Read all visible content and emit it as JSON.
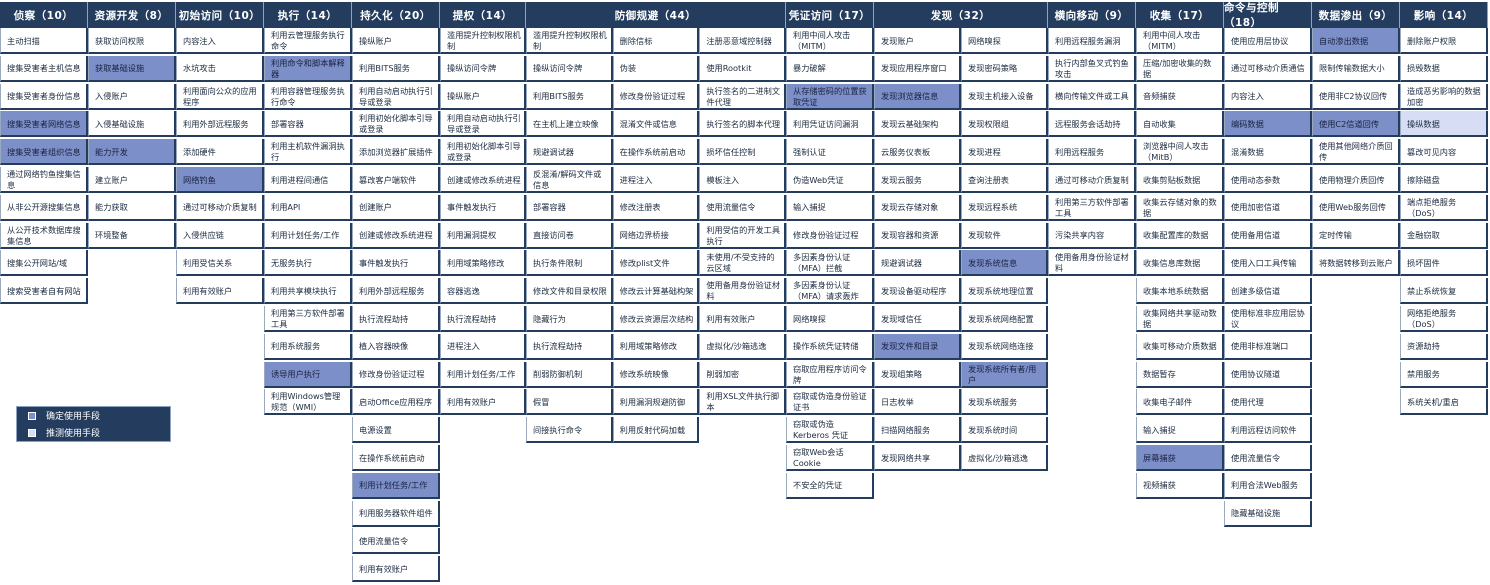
{
  "colors": {
    "header_bg": "#243d5e",
    "confirmed": "#7c8fc9",
    "suspected": "#d6ddf5",
    "cell_border": "#243d5e"
  },
  "legend": {
    "confirmed": "确定使用手段",
    "suspected": "推测使用手段"
  },
  "tactics": [
    {
      "name": "侦察（10）",
      "techniques": [
        {
          "label": "主动扫描",
          "state": ""
        },
        {
          "label": "搜集受害者主机信息",
          "state": ""
        },
        {
          "label": "搜集受害者身份信息",
          "state": ""
        },
        {
          "label": "搜集受害者网络信息",
          "state": "confirmed"
        },
        {
          "label": "搜集受害者组织信息",
          "state": "confirmed"
        },
        {
          "label": "通过网络钓鱼搜集信息",
          "state": ""
        },
        {
          "label": "从非公开源搜集信息",
          "state": ""
        },
        {
          "label": "从公开技术数据库搜集信息",
          "state": ""
        },
        {
          "label": "搜集公开网站/域",
          "state": ""
        },
        {
          "label": "搜索受害者自有网站",
          "state": ""
        }
      ]
    },
    {
      "name": "资源开发（8）",
      "techniques": [
        {
          "label": "获取访问权限",
          "state": ""
        },
        {
          "label": "获取基础设施",
          "state": "confirmed"
        },
        {
          "label": "入侵账户",
          "state": ""
        },
        {
          "label": "入侵基础设施",
          "state": ""
        },
        {
          "label": "能力开发",
          "state": "confirmed"
        },
        {
          "label": "建立账户",
          "state": ""
        },
        {
          "label": "能力获取",
          "state": ""
        },
        {
          "label": "环境整备",
          "state": ""
        }
      ]
    },
    {
      "name": "初始访问（10）",
      "techniques": [
        {
          "label": "内容注入",
          "state": ""
        },
        {
          "label": "水坑攻击",
          "state": ""
        },
        {
          "label": "利用面向公众的应用程序",
          "state": ""
        },
        {
          "label": "利用外部远程服务",
          "state": ""
        },
        {
          "label": "添加硬件",
          "state": ""
        },
        {
          "label": "网络钓鱼",
          "state": "confirmed"
        },
        {
          "label": "通过可移动介质复制",
          "state": ""
        },
        {
          "label": "入侵供应链",
          "state": ""
        },
        {
          "label": "利用受信关系",
          "state": ""
        },
        {
          "label": "利用有效账户",
          "state": ""
        }
      ]
    },
    {
      "name": "执行（14）",
      "techniques": [
        {
          "label": "利用云管理服务执行命令",
          "state": ""
        },
        {
          "label": "利用命令和脚本解释器",
          "state": "confirmed"
        },
        {
          "label": "利用容器管理服务执行命令",
          "state": ""
        },
        {
          "label": "部署容器",
          "state": ""
        },
        {
          "label": "利用主机软件漏洞执行",
          "state": ""
        },
        {
          "label": "利用进程间通信",
          "state": ""
        },
        {
          "label": "利用API",
          "state": ""
        },
        {
          "label": "利用计划任务/工作",
          "state": ""
        },
        {
          "label": "无服务执行",
          "state": ""
        },
        {
          "label": "利用共享模块执行",
          "state": ""
        },
        {
          "label": "利用第三方软件部署工具",
          "state": ""
        },
        {
          "label": "利用系统服务",
          "state": ""
        },
        {
          "label": "诱导用户执行",
          "state": "confirmed"
        },
        {
          "label": "利用Windows管理规范（WMI）",
          "state": ""
        }
      ]
    },
    {
      "name": "持久化（20）",
      "techniques": [
        {
          "label": "操纵账户",
          "state": ""
        },
        {
          "label": "利用BITS服务",
          "state": ""
        },
        {
          "label": "利用自动启动执行引导或登录",
          "state": ""
        },
        {
          "label": "利用初始化脚本引导或登录",
          "state": ""
        },
        {
          "label": "添加浏览器扩展插件",
          "state": ""
        },
        {
          "label": "篡改客户端软件",
          "state": ""
        },
        {
          "label": "创建账户",
          "state": ""
        },
        {
          "label": "创建或修改系统进程",
          "state": ""
        },
        {
          "label": "事件触发执行",
          "state": ""
        },
        {
          "label": "利用外部远程服务",
          "state": ""
        },
        {
          "label": "执行流程劫持",
          "state": ""
        },
        {
          "label": "植入容器映像",
          "state": ""
        },
        {
          "label": "修改身份验证过程",
          "state": ""
        },
        {
          "label": "启动Office应用程序",
          "state": ""
        },
        {
          "label": "电源设置",
          "state": ""
        },
        {
          "label": "在操作系统前启动",
          "state": ""
        },
        {
          "label": "利用计划任务/工作",
          "state": "confirmed"
        },
        {
          "label": "利用服务器软件组件",
          "state": ""
        },
        {
          "label": "使用流量信令",
          "state": ""
        },
        {
          "label": "利用有效账户",
          "state": ""
        }
      ]
    },
    {
      "name": "提权（14）",
      "techniques": [
        {
          "label": "滥用提升控制权限机制",
          "state": ""
        },
        {
          "label": "操纵访问令牌",
          "state": ""
        },
        {
          "label": "操纵账户",
          "state": ""
        },
        {
          "label": "利用自动启动执行引导或登录",
          "state": ""
        },
        {
          "label": "利用初始化脚本引导或登录",
          "state": ""
        },
        {
          "label": "创建或修改系统进程",
          "state": ""
        },
        {
          "label": "事件触发执行",
          "state": ""
        },
        {
          "label": "利用漏洞提权",
          "state": ""
        },
        {
          "label": "利用域策略修改",
          "state": ""
        },
        {
          "label": "容器逃逸",
          "state": ""
        },
        {
          "label": "执行流程劫持",
          "state": ""
        },
        {
          "label": "进程注入",
          "state": ""
        },
        {
          "label": "利用计划任务/工作",
          "state": ""
        },
        {
          "label": "利用有效账户",
          "state": ""
        }
      ]
    },
    {
      "name": "防御规避（44）",
      "techniques": [
        {
          "label": "滥用提升控制权限机制",
          "state": ""
        },
        {
          "label": "操纵访问令牌",
          "state": ""
        },
        {
          "label": "利用BITS服务",
          "state": ""
        },
        {
          "label": "在主机上建立映像",
          "state": ""
        },
        {
          "label": "规避调试器",
          "state": ""
        },
        {
          "label": "反混淆/解码文件或信息",
          "state": ""
        },
        {
          "label": "部署容器",
          "state": ""
        },
        {
          "label": "直接访问卷",
          "state": ""
        },
        {
          "label": "执行条件限制",
          "state": ""
        },
        {
          "label": "修改文件和目录权限",
          "state": ""
        },
        {
          "label": "隐藏行为",
          "state": ""
        },
        {
          "label": "执行流程劫持",
          "state": ""
        },
        {
          "label": "削弱防御机制",
          "state": ""
        },
        {
          "label": "假冒",
          "state": ""
        },
        {
          "label": "间接执行命令",
          "state": ""
        },
        {
          "label": "删除信标",
          "state": ""
        },
        {
          "label": "伪装",
          "state": ""
        },
        {
          "label": "修改身份验证过程",
          "state": ""
        },
        {
          "label": "混淆文件或信息",
          "state": ""
        },
        {
          "label": "在操作系统前启动",
          "state": ""
        },
        {
          "label": "进程注入",
          "state": ""
        },
        {
          "label": "修改注册表",
          "state": ""
        },
        {
          "label": "网络边界桥接",
          "state": ""
        },
        {
          "label": "修改plist文件",
          "state": ""
        },
        {
          "label": "修改云计算基础构架",
          "state": ""
        },
        {
          "label": "修改云资源层次结构",
          "state": ""
        },
        {
          "label": "利用域策略修改",
          "state": ""
        },
        {
          "label": "修改系统映像",
          "state": ""
        },
        {
          "label": "利用漏洞规避防御",
          "state": ""
        },
        {
          "label": "利用反射代码加载",
          "state": ""
        },
        {
          "label": "注册恶意域控制器",
          "state": ""
        },
        {
          "label": "使用Rootkit",
          "state": ""
        },
        {
          "label": "执行签名的二进制文件代理",
          "state": ""
        },
        {
          "label": "执行签名的脚本代理",
          "state": ""
        },
        {
          "label": "损坏信任控制",
          "state": ""
        },
        {
          "label": "模板注入",
          "state": ""
        },
        {
          "label": "使用流量信令",
          "state": ""
        },
        {
          "label": "利用受信的开发工具执行",
          "state": ""
        },
        {
          "label": "未使用/不受支持的云区域",
          "state": ""
        },
        {
          "label": "使用备用身份验证材料",
          "state": ""
        },
        {
          "label": "利用有效账户",
          "state": ""
        },
        {
          "label": "虚拟化/沙箱逃逸",
          "state": ""
        },
        {
          "label": "削弱加密",
          "state": ""
        },
        {
          "label": "利用XSL文件执行脚本",
          "state": ""
        }
      ]
    },
    {
      "name": "凭证访问（17）",
      "techniques": [
        {
          "label": "利用中间人攻击（MITM）",
          "state": ""
        },
        {
          "label": "暴力破解",
          "state": ""
        },
        {
          "label": "从存储密码的位置获取凭证",
          "state": "confirmed"
        },
        {
          "label": "利用凭证访问漏洞",
          "state": ""
        },
        {
          "label": "强制认证",
          "state": ""
        },
        {
          "label": "伪造Web凭证",
          "state": ""
        },
        {
          "label": "输入捕捉",
          "state": ""
        },
        {
          "label": "修改身份验证过程",
          "state": ""
        },
        {
          "label": "多因素身份认证（MFA）拦截",
          "state": ""
        },
        {
          "label": "多因素身份认证（MFA）请求轰炸",
          "state": ""
        },
        {
          "label": "网络嗅探",
          "state": ""
        },
        {
          "label": "操作系统凭证转储",
          "state": ""
        },
        {
          "label": "窃取应用程序访问令牌",
          "state": ""
        },
        {
          "label": "窃取或伪造身份验证证书",
          "state": ""
        },
        {
          "label": "窃取或伪造Kerberos 凭证",
          "state": ""
        },
        {
          "label": "窃取Web会话Cookie",
          "state": ""
        },
        {
          "label": "不安全的凭证",
          "state": ""
        }
      ]
    },
    {
      "name": "发现（32）",
      "techniques": [
        {
          "label": "发现账户",
          "state": ""
        },
        {
          "label": "发现应用程序窗口",
          "state": ""
        },
        {
          "label": "发现浏览器信息",
          "state": "confirmed"
        },
        {
          "label": "发现云基础架构",
          "state": ""
        },
        {
          "label": "云服务仪表板",
          "state": ""
        },
        {
          "label": "发现云服务",
          "state": ""
        },
        {
          "label": "发现云存储对象",
          "state": ""
        },
        {
          "label": "发现容器和资源",
          "state": ""
        },
        {
          "label": "规避调试器",
          "state": ""
        },
        {
          "label": "发现设备驱动程序",
          "state": ""
        },
        {
          "label": "发现域信任",
          "state": ""
        },
        {
          "label": "发现文件和目录",
          "state": "confirmed"
        },
        {
          "label": "发现组策略",
          "state": ""
        },
        {
          "label": "日志枚举",
          "state": ""
        },
        {
          "label": "扫描网络服务",
          "state": ""
        },
        {
          "label": "发现网络共享",
          "state": ""
        },
        {
          "label": "网络嗅探",
          "state": ""
        },
        {
          "label": "发现密码策略",
          "state": ""
        },
        {
          "label": "发现主机接入设备",
          "state": ""
        },
        {
          "label": "发现权限组",
          "state": ""
        },
        {
          "label": "发现进程",
          "state": ""
        },
        {
          "label": "查询注册表",
          "state": ""
        },
        {
          "label": "发现远程系统",
          "state": ""
        },
        {
          "label": "发现软件",
          "state": ""
        },
        {
          "label": "发现系统信息",
          "state": "confirmed"
        },
        {
          "label": "发现系统地理位置",
          "state": ""
        },
        {
          "label": "发现系统网络配置",
          "state": ""
        },
        {
          "label": "发现系统网络连接",
          "state": ""
        },
        {
          "label": "发现系统所有者/用户",
          "state": "confirmed"
        },
        {
          "label": "发现系统服务",
          "state": ""
        },
        {
          "label": "发现系统时间",
          "state": ""
        },
        {
          "label": "虚拟化/沙箱逃逸",
          "state": ""
        }
      ]
    },
    {
      "name": "横向移动（9）",
      "techniques": [
        {
          "label": "利用远程服务漏洞",
          "state": ""
        },
        {
          "label": "执行内部鱼叉式钓鱼攻击",
          "state": ""
        },
        {
          "label": "横向传输文件或工具",
          "state": ""
        },
        {
          "label": "远程服务会话劫持",
          "state": ""
        },
        {
          "label": "利用远程服务",
          "state": ""
        },
        {
          "label": "通过可移动介质复制",
          "state": ""
        },
        {
          "label": "利用第三方软件部署工具",
          "state": ""
        },
        {
          "label": "污染共享内容",
          "state": ""
        },
        {
          "label": "使用备用身份验证材料",
          "state": ""
        }
      ]
    },
    {
      "name": "收集（17）",
      "techniques": [
        {
          "label": "利用中间人攻击（MITM）",
          "state": ""
        },
        {
          "label": "压缩/加密收集的数据",
          "state": ""
        },
        {
          "label": "音频捕获",
          "state": ""
        },
        {
          "label": "自动收集",
          "state": ""
        },
        {
          "label": "浏览器中间人攻击（MitB）",
          "state": ""
        },
        {
          "label": "收集剪贴板数据",
          "state": ""
        },
        {
          "label": "收集云存储对象的数据",
          "state": ""
        },
        {
          "label": "收集配置库的数据",
          "state": ""
        },
        {
          "label": "收集信息库数据",
          "state": ""
        },
        {
          "label": "收集本地系统数据",
          "state": ""
        },
        {
          "label": "收集网络共享驱动数据",
          "state": ""
        },
        {
          "label": "收集可移动介质数据",
          "state": ""
        },
        {
          "label": "数据暂存",
          "state": ""
        },
        {
          "label": "收集电子邮件",
          "state": ""
        },
        {
          "label": "输入捕捉",
          "state": ""
        },
        {
          "label": "屏幕捕获",
          "state": "confirmed"
        },
        {
          "label": "视频捕获",
          "state": ""
        }
      ]
    },
    {
      "name": "命令与控制（18）",
      "techniques": [
        {
          "label": "使用应用层协议",
          "state": ""
        },
        {
          "label": "通过可移动介质通信",
          "state": ""
        },
        {
          "label": "内容注入",
          "state": ""
        },
        {
          "label": "编码数据",
          "state": "confirmed"
        },
        {
          "label": "混淆数据",
          "state": ""
        },
        {
          "label": "使用动态参数",
          "state": ""
        },
        {
          "label": "使用加密信道",
          "state": ""
        },
        {
          "label": "使用备用信道",
          "state": ""
        },
        {
          "label": "使用入口工具传输",
          "state": ""
        },
        {
          "label": "创建多级信道",
          "state": ""
        },
        {
          "label": "使用标准非应用层协议",
          "state": ""
        },
        {
          "label": "使用非标准端口",
          "state": ""
        },
        {
          "label": "使用协议隧道",
          "state": ""
        },
        {
          "label": "使用代理",
          "state": ""
        },
        {
          "label": "利用远程访问软件",
          "state": ""
        },
        {
          "label": "使用流量信令",
          "state": ""
        },
        {
          "label": "利用合法Web服务",
          "state": ""
        },
        {
          "label": "隐藏基础设施",
          "state": ""
        }
      ]
    },
    {
      "name": "数据渗出（9）",
      "techniques": [
        {
          "label": "自动渗出数据",
          "state": "confirmed"
        },
        {
          "label": "限制传输数据大小",
          "state": ""
        },
        {
          "label": "使用非C2协议回传",
          "state": ""
        },
        {
          "label": "使用C2信道回传",
          "state": "confirmed"
        },
        {
          "label": "使用其他网络介质回传",
          "state": ""
        },
        {
          "label": "使用物理介质回传",
          "state": ""
        },
        {
          "label": "使用Web服务回传",
          "state": ""
        },
        {
          "label": "定时传输",
          "state": ""
        },
        {
          "label": "将数据转移到云账户",
          "state": ""
        }
      ]
    },
    {
      "name": "影响（14）",
      "techniques": [
        {
          "label": "删除账户权限",
          "state": ""
        },
        {
          "label": "损毁数据",
          "state": ""
        },
        {
          "label": "造成恶劣影响的数据加密",
          "state": ""
        },
        {
          "label": "操纵数据",
          "state": "suspected"
        },
        {
          "label": "篡改可见内容",
          "state": ""
        },
        {
          "label": "擦除磁盘",
          "state": ""
        },
        {
          "label": "端点拒绝服务（DoS）",
          "state": ""
        },
        {
          "label": "金融窃取",
          "state": ""
        },
        {
          "label": "损坏固件",
          "state": ""
        },
        {
          "label": "禁止系统恢复",
          "state": ""
        },
        {
          "label": "网络拒绝服务（DoS）",
          "state": ""
        },
        {
          "label": "资源劫持",
          "state": ""
        },
        {
          "label": "禁用服务",
          "state": ""
        },
        {
          "label": "系统关机/重启",
          "state": ""
        }
      ]
    }
  ]
}
